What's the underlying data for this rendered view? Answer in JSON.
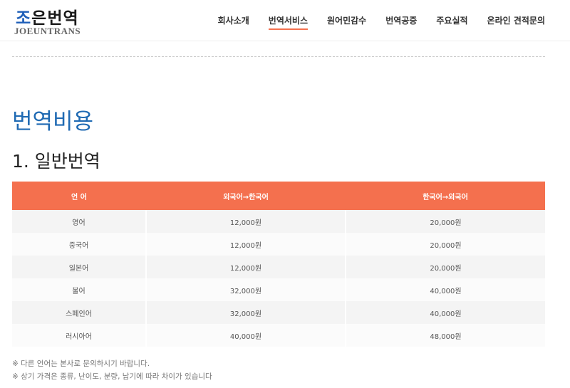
{
  "logo": {
    "first_char": "조",
    "rest": "은번역",
    "sub": "JOEUNTRANS"
  },
  "nav": {
    "items": [
      {
        "label": "회사소개",
        "active": false
      },
      {
        "label": "번역서비스",
        "active": true
      },
      {
        "label": "원어민감수",
        "active": false
      },
      {
        "label": "번역공증",
        "active": false
      },
      {
        "label": "주요실적",
        "active": false
      },
      {
        "label": "온라인 견적문의",
        "active": false
      }
    ]
  },
  "page": {
    "title": "번역비용",
    "section_title": "1. 일반번역"
  },
  "table": {
    "headers": [
      "언 어",
      "외국어→한국어",
      "한국어→외국어"
    ],
    "rows": [
      {
        "language": "영어",
        "to_korean": "12,000원",
        "from_korean": "20,000원"
      },
      {
        "language": "중국어",
        "to_korean": "12,000원",
        "from_korean": "20,000원"
      },
      {
        "language": "일본어",
        "to_korean": "12,000원",
        "from_korean": "20,000원"
      },
      {
        "language": "불어",
        "to_korean": "32,000원",
        "from_korean": "40,000원"
      },
      {
        "language": "스페인어",
        "to_korean": "32,000원",
        "from_korean": "40,000원"
      },
      {
        "language": "러시아어",
        "to_korean": "40,000원",
        "from_korean": "48,000원"
      }
    ]
  },
  "notes": [
    "※ 다른 언어는 본사로 문의하시기 바랍니다.",
    "※ 상기 가격은 종류, 난이도, 분량, 납기에 따라 차이가 있습니다"
  ],
  "colors": {
    "accent": "#f4704e",
    "title_blue": "#1f6ab3",
    "logo_blue": "#1f5fb8"
  }
}
